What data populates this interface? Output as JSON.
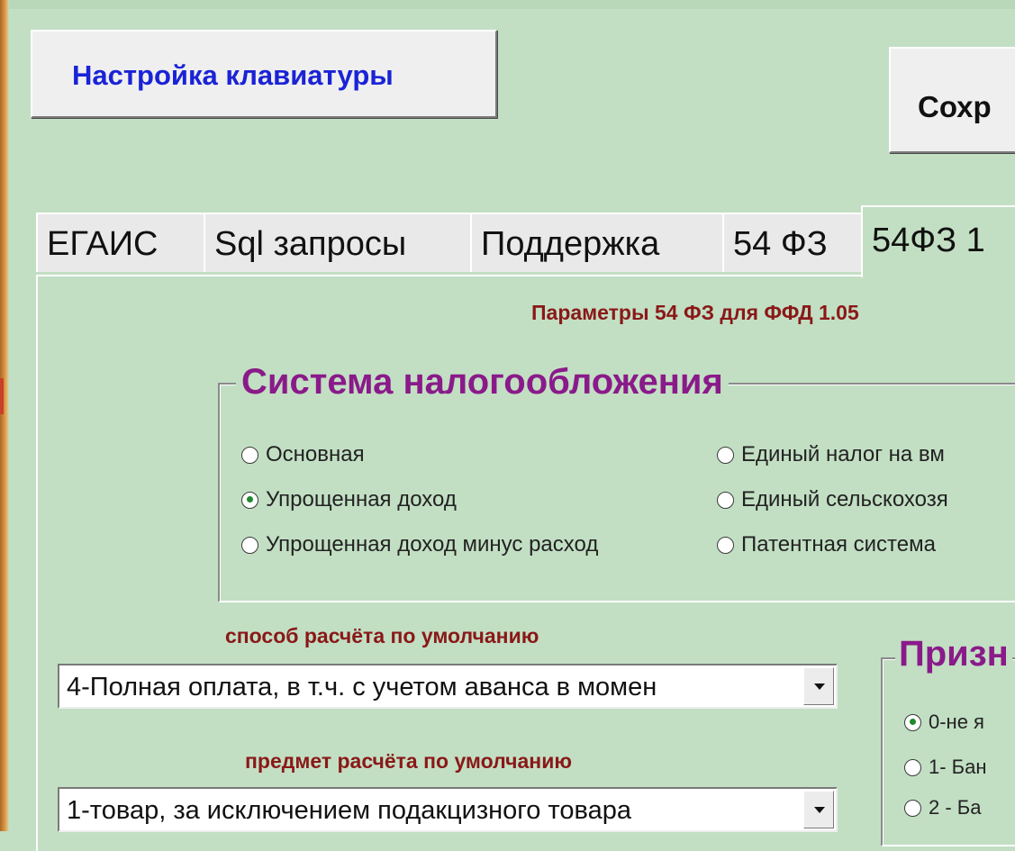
{
  "toolbar": {
    "keyboard_label": "Настройка клавиатуры",
    "save_label": "Сохр"
  },
  "tabs": [
    {
      "label": "ЕГАИС",
      "active": false
    },
    {
      "label": "Sql запросы",
      "active": false
    },
    {
      "label": "Поддержка",
      "active": false
    },
    {
      "label": "54 ФЗ",
      "active": false
    },
    {
      "label": "54ФЗ 1",
      "active": true
    }
  ],
  "page": {
    "title": "Параметры 54 ФЗ для ФФД 1.05"
  },
  "tax_system": {
    "title": "Система налогообложения",
    "options": [
      {
        "label": "Основная",
        "checked": false
      },
      {
        "label": "Упрощенная доход",
        "checked": true
      },
      {
        "label": "Упрощенная доход минус расход",
        "checked": false
      },
      {
        "label": "Единый налог на вм",
        "checked": false
      },
      {
        "label": "Единый сельскохозя",
        "checked": false
      },
      {
        "label": "Патентная система",
        "checked": false
      }
    ]
  },
  "payment_method": {
    "label": "способ расчёта по умолчанию",
    "value": "4-Полная оплата, в т.ч. с учетом аванса в момен"
  },
  "payment_subject": {
    "label": "предмет расчёта по умолчанию",
    "value": "1-товар, за исключением подакцизного товара"
  },
  "agent_sign": {
    "title": "Призн",
    "options": [
      {
        "label": "0-не я",
        "checked": true
      },
      {
        "label": "1- Бан",
        "checked": false
      },
      {
        "label": "2 - Ба",
        "checked": false
      }
    ]
  },
  "colors": {
    "background": "#c2dfc3",
    "accent_blue": "#1a23d6",
    "label_red": "#8a1818",
    "group_title_purple": "#8a1a8a"
  }
}
